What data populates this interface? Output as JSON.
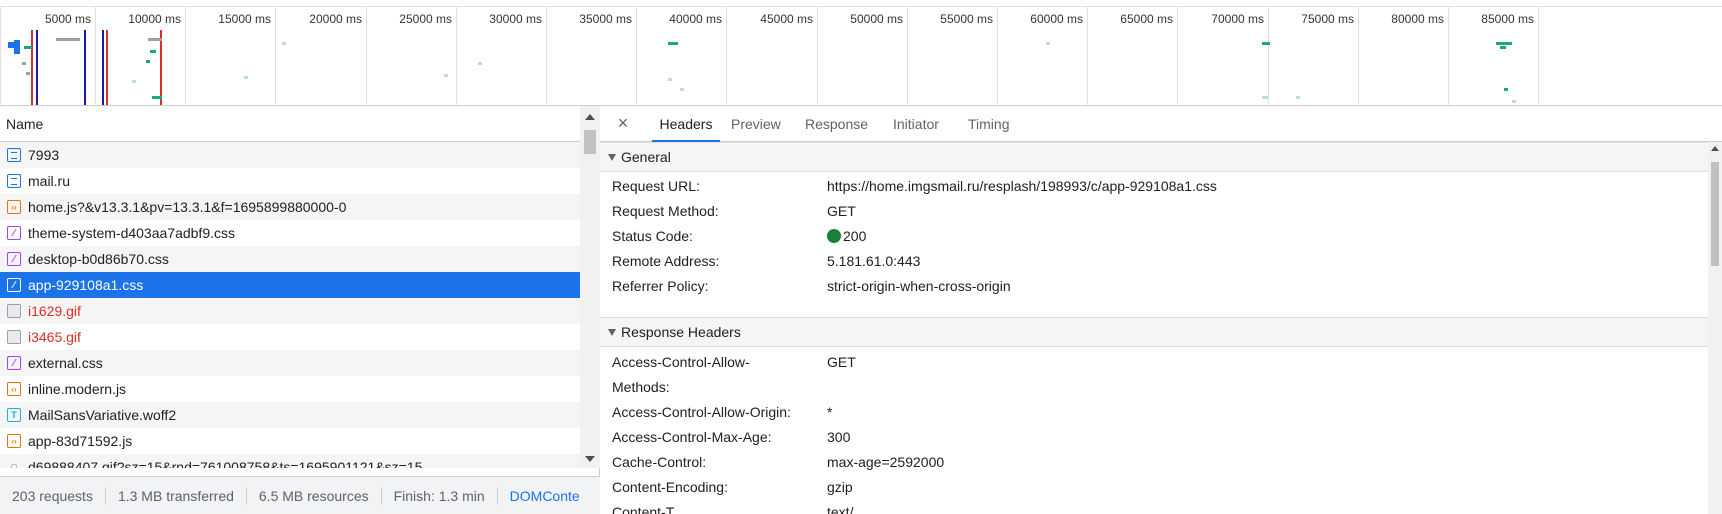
{
  "overview": {
    "ticks": [
      "5000 ms",
      "10000 ms",
      "15000 ms",
      "20000 ms",
      "25000 ms",
      "30000 ms",
      "35000 ms",
      "40000 ms",
      "45000 ms",
      "50000 ms",
      "55000 ms",
      "60000 ms",
      "65000 ms",
      "70000 ms",
      "75000 ms",
      "80000 ms",
      "85000 ms"
    ],
    "colors": {
      "dom_content_loaded": "#1a1aa6",
      "load": "#d93025",
      "waterfall": "#1ba784"
    }
  },
  "request_list": {
    "column_name": "Name",
    "rows": [
      {
        "name": "7993",
        "type": "doc-icon",
        "error": false,
        "selected": false
      },
      {
        "name": "mail.ru",
        "type": "doc-icon",
        "error": false,
        "selected": false
      },
      {
        "name": "home.js?&v13.3.1&pv=13.3.1&f=1695899880000-0",
        "type": "script-icon",
        "error": false,
        "selected": false
      },
      {
        "name": "theme-system-d403aa7adbf9.css",
        "type": "style-icon",
        "error": false,
        "selected": false
      },
      {
        "name": "desktop-b0d86b70.css",
        "type": "style-icon",
        "error": false,
        "selected": false
      },
      {
        "name": "app-929108a1.css",
        "type": "style-icon",
        "error": false,
        "selected": true
      },
      {
        "name": "i1629.gif",
        "type": "image-icon",
        "error": true,
        "selected": false
      },
      {
        "name": "i3465.gif",
        "type": "image-icon",
        "error": true,
        "selected": false
      },
      {
        "name": "external.css",
        "type": "style-icon",
        "error": false,
        "selected": false
      },
      {
        "name": "inline.modern.js",
        "type": "script-icon",
        "error": false,
        "selected": false
      },
      {
        "name": "MailSansVariative.woff2",
        "type": "font-icon",
        "error": false,
        "selected": false
      },
      {
        "name": "app-83d71592.js",
        "type": "script-icon",
        "error": false,
        "selected": false
      },
      {
        "name": "d69888407.gif?sz=15&rnd=761008758&ts=1695901121&sz=15",
        "type": "other-icon",
        "error": false,
        "selected": false
      }
    ]
  },
  "status_bar": {
    "requests": "203 requests",
    "transferred": "1.3 MB transferred",
    "resources": "6.5 MB resources",
    "finish": "Finish: 1.3 min",
    "dom_content": "DOMConte"
  },
  "detail": {
    "close_icon": "×",
    "tabs": [
      "Headers",
      "Preview",
      "Response",
      "Initiator",
      "Timing"
    ],
    "general": {
      "title": "General",
      "request_url_k": "Request URL:",
      "request_url_v": "https://home.imgsmail.ru/resplash/198993/c/app-929108a1.css",
      "method_k": "Request Method:",
      "method_v": "GET",
      "status_k": "Status Code:",
      "status_v": "200",
      "remote_k": "Remote Address:",
      "remote_v": "5.181.61.0:443",
      "referrer_k": "Referrer Policy:",
      "referrer_v": "strict-origin-when-cross-origin"
    },
    "response_headers": {
      "title": "Response Headers",
      "acam_k1": "Access-Control-Allow-",
      "acam_k2": "Methods:",
      "acam_v": "GET",
      "acao_k": "Access-Control-Allow-Origin:",
      "acao_v": "*",
      "acma_k": "Access-Control-Max-Age:",
      "acma_v": "300",
      "cc_k": "Cache-Control:",
      "cc_v": "max-age=2592000",
      "ce_k": "Content-Encoding:",
      "ce_v": "gzip",
      "ct_k": "Content-T",
      "ct_v": "text/"
    }
  }
}
